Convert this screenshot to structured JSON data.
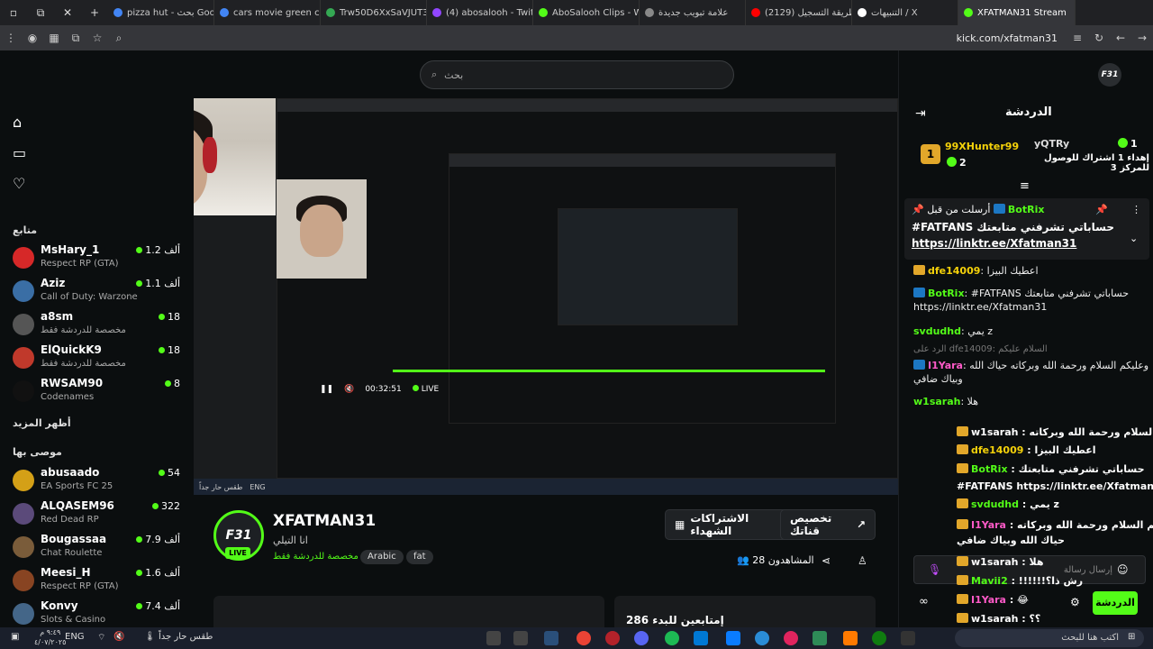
{
  "tabs": [
    {
      "label": "pizza hut - بحث Goog",
      "color": "#4285f4"
    },
    {
      "label": "cars movie green ca",
      "color": "#4285f4"
    },
    {
      "label": "Trw50D6XxSaVJUT30",
      "color": "#34a853"
    },
    {
      "label": "(4) abosalooh - Twitc",
      "color": "#9146ff"
    },
    {
      "label": "AboSalooh Clips - W",
      "color": "#53fc18"
    },
    {
      "label": "علامة تبويب جديدة",
      "color": "#888888"
    },
    {
      "label": "(2129) طريقة التسجيل",
      "color": "#ff0000"
    },
    {
      "label": "التنبيهات / X",
      "color": "#ffffff"
    },
    {
      "label": "XFATMAN31 Stream",
      "color": "#53fc18"
    }
  ],
  "url": "kick.com/xfatman31",
  "search": {
    "placeholder": "بحث"
  },
  "leftnav": {
    "following_title": "متابع",
    "show_more": "أظهر المزيد",
    "recommended_title": "موصى بها",
    "following": [
      {
        "name": "MsHary_1",
        "category": "Respect RP (GTA)",
        "count": "1.2 ألف",
        "color": "#d62828"
      },
      {
        "name": "Aziz",
        "category": "Call of Duty: Warzone",
        "count": "1.1 ألف",
        "color": "#3a6ea5"
      },
      {
        "name": "a8sm",
        "category": "مخصصة للدردشة فقط",
        "count": "18",
        "color": "#555555"
      },
      {
        "name": "ElQuickK9",
        "category": "مخصصة للدردشة فقط",
        "count": "18",
        "color": "#c0392b"
      },
      {
        "name": "RWSAM90",
        "category": "Codenames",
        "count": "8",
        "color": "#111111"
      }
    ],
    "recommended": [
      {
        "name": "abusaado",
        "category": "EA Sports FC 25",
        "count": "54",
        "color": "#d4a017"
      },
      {
        "name": "ALQASEM96",
        "category": "Red Dead RP",
        "count": "322",
        "color": "#5b4a7a"
      },
      {
        "name": "Bougassaa",
        "category": "Chat Roulette",
        "count": "7.9 ألف",
        "color": "#7a5c3a"
      },
      {
        "name": "Meesi_H",
        "category": "Respect RP (GTA)",
        "count": "1.6 ألف",
        "color": "#884422"
      },
      {
        "name": "Konvy",
        "category": "Slots & Casino",
        "count": "7.4 ألف",
        "color": "#446688"
      }
    ]
  },
  "video": {
    "time": "00:32:51",
    "live": "LIVE"
  },
  "channel": {
    "logo": "F31",
    "live": "LIVE",
    "name": "XFATMAN31",
    "subtitle": "انا التيلي",
    "category": "مخصصة للدردشة فقط",
    "tags": [
      "Arabic",
      "fat"
    ],
    "customize_label": "تخصيص قناتك",
    "subs_label": "الاشتراكات الشهداء",
    "viewers": "28 المشاهدون",
    "card_title": "286 إمتابعين للبدء"
  },
  "chat": {
    "logo": "F31",
    "title": "الدردشة",
    "gift_top_name": "99XHunter99",
    "gift_top_count": "2",
    "gift_second_name": "yQTRy",
    "gift_second_count": "1",
    "gift_text": "إهداء 1 اشتراك للوصول للمركز 3",
    "pinned_by": "أرسلت من قبل",
    "pinned_user": "BotRix",
    "pinned_text": "#FATFANS حساباتي تشرفني متابعتك",
    "pinned_link": "https://linktr.ee/Xfatman31",
    "messages": [
      {
        "user": "dfe14009",
        "text": "اعطيك البيزا",
        "ucls": "u-yellow",
        "badge": "b-gold"
      },
      {
        "user": "BotRix",
        "text": "#FATFANS حساباتي تشرفني متابعتك https://linktr.ee/Xfatman31",
        "ucls": "u-green",
        "badge": "b-blue"
      },
      {
        "user": "svdudhd",
        "text": "يمي z",
        "ucls": "u-green",
        "badge": ""
      },
      {
        "user": "I1Yara",
        "text": "وعليكم السلام ورحمة الله وبركاته حياك الله وبياك ضافي",
        "ucls": "u-pink",
        "badge": "b-blue"
      },
      {
        "user": "w1sarah",
        "text": "هلا",
        "ucls": "u-green",
        "badge": ""
      }
    ],
    "reply_text": "الرد على dfe14009: السلام عليكم",
    "input_placeholder": "إرسال رسالة",
    "send_label": "الدردشة"
  },
  "overlay": [
    {
      "user": "w1sarah",
      "text": "وعليكم السلام ورحمة الله وبركاته",
      "ucls": "u-white"
    },
    {
      "user": "dfe14009",
      "text": "اعطيك البيزا",
      "ucls": "u-yellow"
    },
    {
      "user": "BotRix",
      "text": "حساباتي تشرفني متابعتك",
      "ucls": "u-green"
    },
    {
      "user": "",
      "text": "#FATFANS https://linktr.ee/Xfatman31",
      "ucls": "u-white"
    },
    {
      "user": "svdudhd",
      "text": "يمي z",
      "ucls": "u-green"
    },
    {
      "user": "I1Yara",
      "text": "وعليكم السلام ورحمة الله وبركاته",
      "ucls": "u-pink"
    },
    {
      "user": "",
      "text": "حياك الله وبياك ضافي",
      "ucls": "u-white"
    },
    {
      "user": "w1sarah",
      "text": "هلا",
      "ucls": "u-white"
    },
    {
      "user": "Mavii2",
      "text": "!!!!!!رش ذا؟",
      "ucls": "u-green"
    },
    {
      "user": "I1Yara",
      "text": "😂",
      "ucls": "u-pink"
    },
    {
      "user": "w1sarah",
      "text": "؟؟",
      "ucls": "u-white"
    },
    {
      "user": "w1sarah",
      "text": "اكتب هنا للبحث",
      "ucls": "u-white"
    }
  ],
  "taskbar": {
    "weather": "طقس حار جداً",
    "lang": "ENG",
    "time": "٩:٤٩ م",
    "date": "٤/٠٧/٢٠٢٥"
  }
}
